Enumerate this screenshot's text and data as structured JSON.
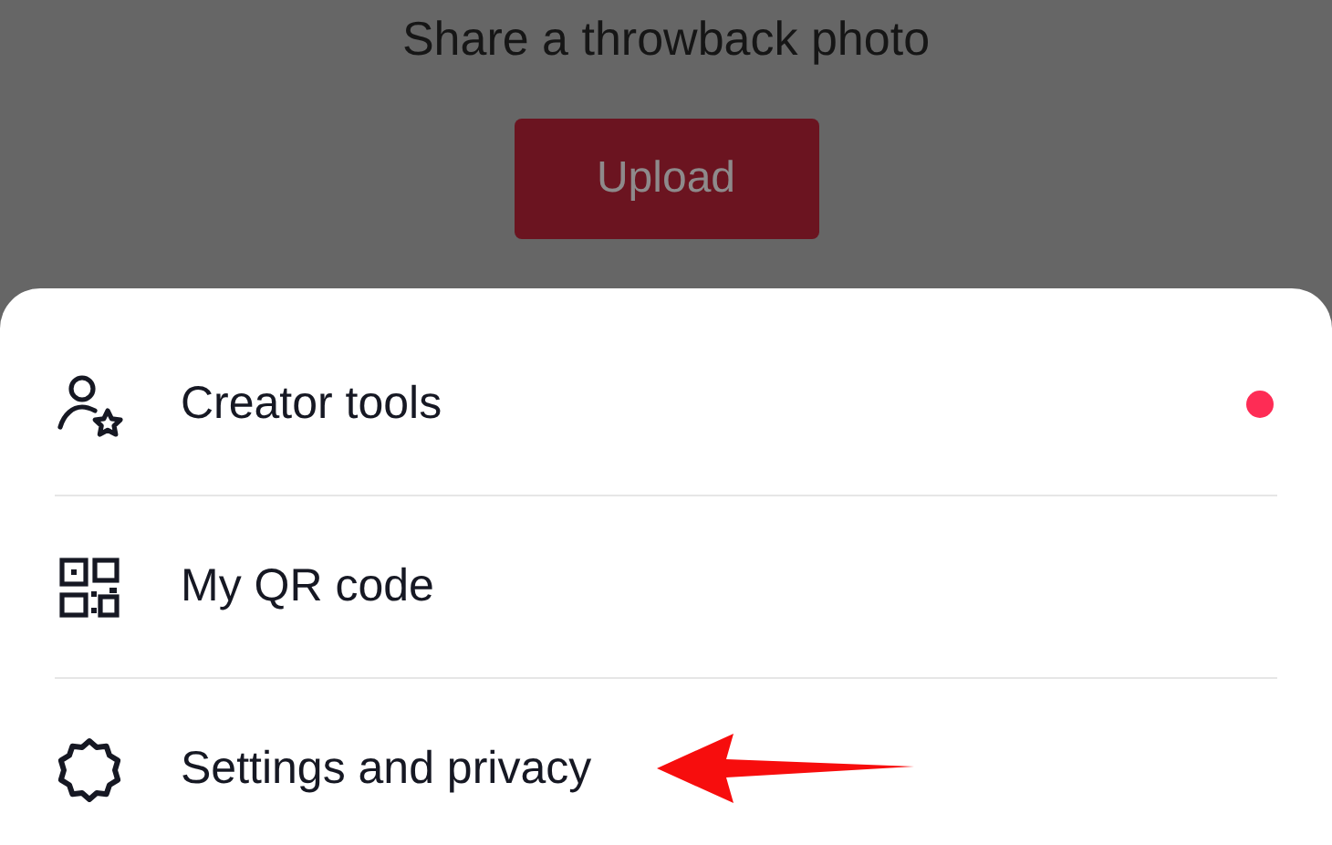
{
  "backdrop": {
    "title": "Share a throwback photo",
    "button": "Upload"
  },
  "menu": [
    {
      "label": "Creator tools",
      "kind": "creator",
      "dot": true
    },
    {
      "label": "My QR code",
      "kind": "qr",
      "dot": false
    },
    {
      "label": "Settings and privacy",
      "kind": "settings",
      "dot": false
    }
  ]
}
